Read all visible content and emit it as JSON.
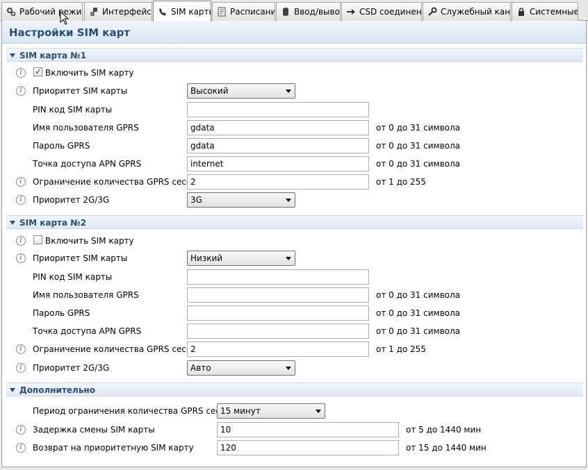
{
  "tabs": [
    {
      "label": "Рабочий режим",
      "icon": "gears-icon"
    },
    {
      "label": "Интерфейсы",
      "icon": "plug-icon"
    },
    {
      "label": "SIM карты",
      "icon": "phone-icon"
    },
    {
      "label": "Расписание",
      "icon": "schedule-icon"
    },
    {
      "label": "Ввод/вывод",
      "icon": "database-icon"
    },
    {
      "label": "CSD соединение",
      "icon": "arrow-right-icon"
    },
    {
      "label": "Служебный канал",
      "icon": "wrench-icon"
    },
    {
      "label": "Системные",
      "icon": "lock-icon"
    }
  ],
  "active_tab": "SIM карты",
  "page_title": "Настройки SIM карт",
  "sim1": {
    "title": "SIM карта №1",
    "enable_label": "Включить SIM карту",
    "enabled": true,
    "priority_label": "Приоритет SIM карты",
    "priority_value": "Высокий",
    "pin_label": "PIN код SIM карты",
    "pin_value": "",
    "user_label": "Имя пользователя GPRS",
    "user_value": "gdata",
    "user_hint": "от 0 до 31 символа",
    "password_label": "Пароль GPRS",
    "password_value": "gdata",
    "password_hint": "от 0 до 31 символа",
    "apn_label": "Точка доступа APN GPRS",
    "apn_value": "internet",
    "apn_hint": "от 0 до 31 символа",
    "sessions_label": "Ограничение количества GPRS сессий",
    "sessions_value": "2",
    "sessions_hint": "от 1 до 255",
    "net_label": "Приоритет 2G/3G",
    "net_value": "3G"
  },
  "sim2": {
    "title": "SIM карта №2",
    "enable_label": "Включить SIM карту",
    "enabled": false,
    "priority_label": "Приоритет SIM карты",
    "priority_value": "Низкий",
    "pin_label": "PIN код SIM карты",
    "pin_value": "",
    "user_label": "Имя пользователя GPRS",
    "user_value": "",
    "user_hint": "от 0 до 31 символа",
    "password_label": "Пароль GPRS",
    "password_value": "",
    "password_hint": "от 0 до 31 символа",
    "apn_label": "Точка доступа APN GPRS",
    "apn_value": "",
    "apn_hint": "от 0 до 31 символа",
    "sessions_label": "Ограничение количества GPRS сессий",
    "sessions_value": "2",
    "sessions_hint": "от 1 до 255",
    "net_label": "Приоритет 2G/3G",
    "net_value": "Авто"
  },
  "extra": {
    "title": "Дополнительно",
    "period_label": "Период ограничения количества GPRS сессий",
    "period_value": "15 минут",
    "delay_label": "Задержка смены SIM карты",
    "delay_value": "10",
    "delay_hint": "от 5 до 1440 мин",
    "return_label": "Возврат на приоритетную SIM карту",
    "return_value": "120",
    "return_hint": "от 15 до 1440 мин"
  },
  "colors": {
    "accent": "#2b4c74",
    "header_bg": "#d9e6f4"
  }
}
